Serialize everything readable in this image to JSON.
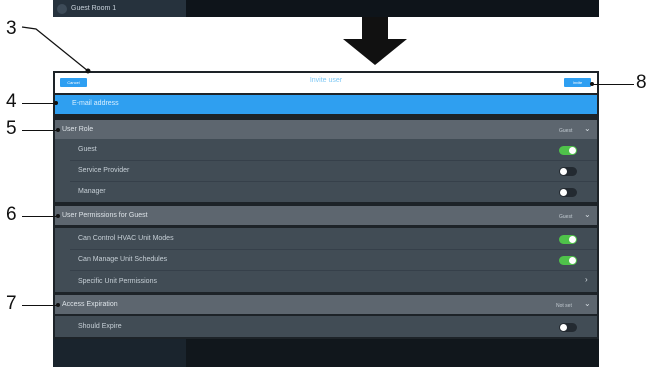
{
  "previous_screen": {
    "room_name": "Guest Room 1"
  },
  "header": {
    "cancel_label": "Cancel",
    "title": "Invite user",
    "invite_label": "Invite"
  },
  "email": {
    "placeholder": "E-mail address"
  },
  "user_role": {
    "label": "User Role",
    "value": "Guest",
    "options": [
      {
        "label": "Guest",
        "on": true
      },
      {
        "label": "Service Provider",
        "on": false
      },
      {
        "label": "Manager",
        "on": false
      }
    ]
  },
  "permissions": {
    "label": "User Permissions for Guest",
    "value": "Guest",
    "items": [
      {
        "label": "Can Control HVAC Unit Modes",
        "on": true
      },
      {
        "label": "Can Manage Unit Schedules",
        "on": true
      }
    ],
    "specific_label": "Specific Unit Permissions"
  },
  "access": {
    "label": "Access Expiration",
    "value": "Not set",
    "should_expire_label": "Should Expire",
    "should_expire_on": false
  },
  "callouts": [
    "3",
    "4",
    "5",
    "6",
    "7",
    "8"
  ],
  "colors": {
    "accent": "#2e9ff2",
    "toggle_on": "#4fc24a",
    "panel": "#1d2328"
  }
}
